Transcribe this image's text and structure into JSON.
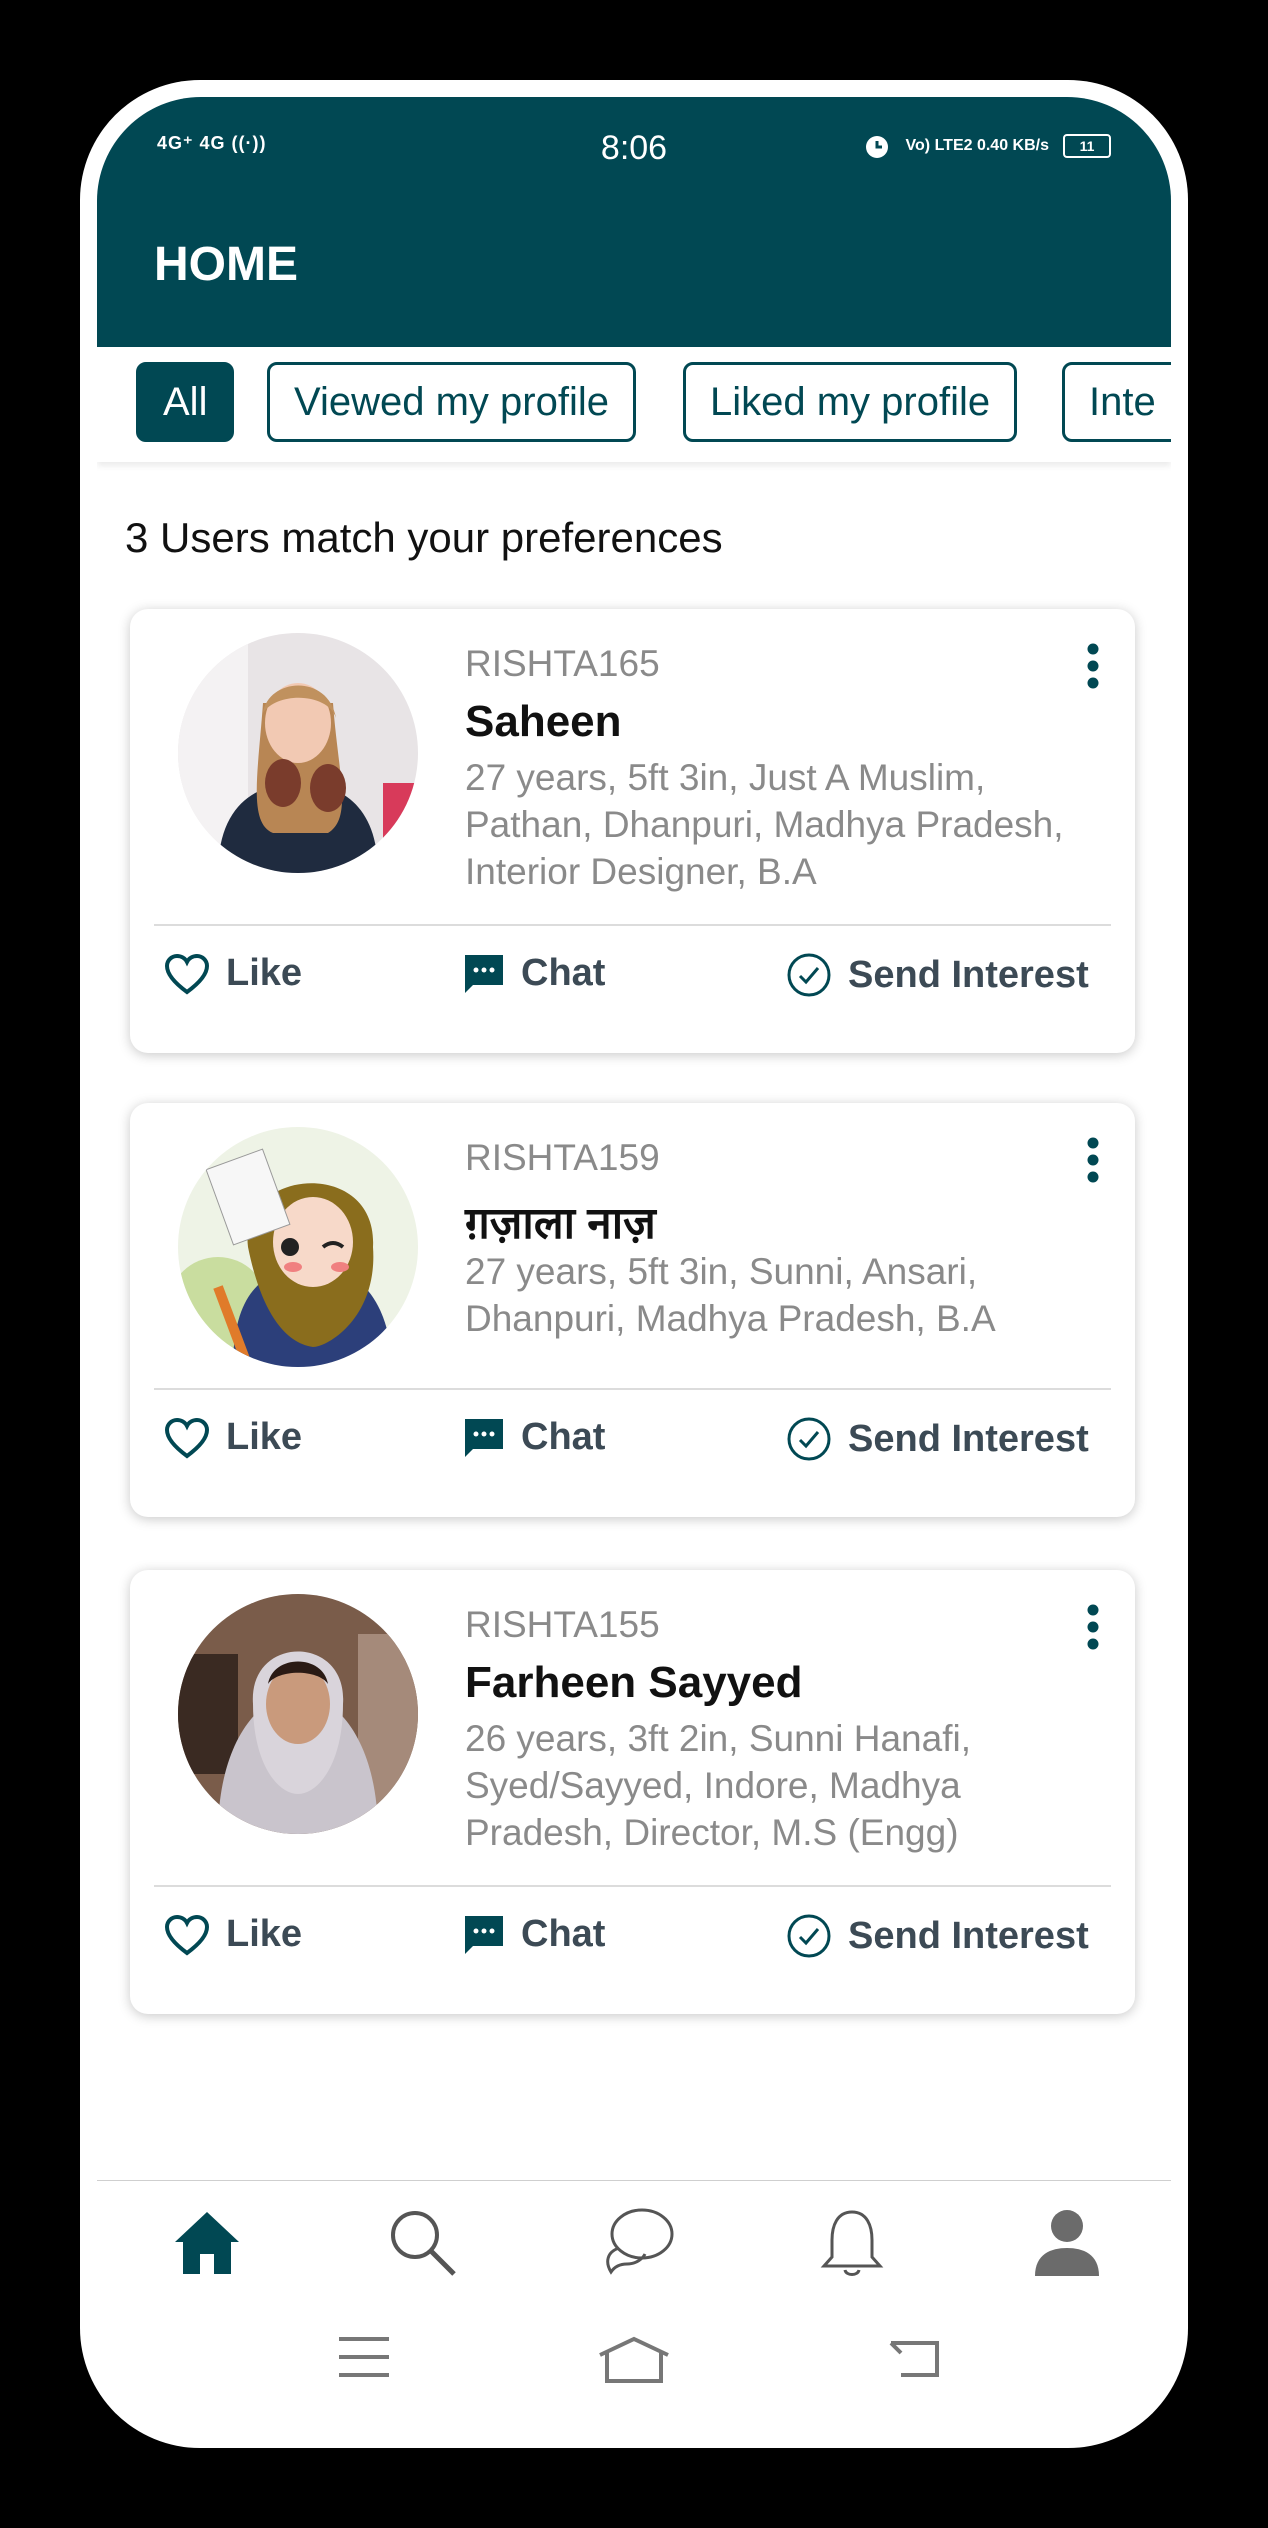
{
  "status_bar": {
    "signal_text": "4G⁺ 4G ((·))",
    "time": "8:06",
    "right_text": "Vo) LTE2 0.40 KB/s",
    "battery": "11"
  },
  "header": {
    "title": "HOME"
  },
  "tabs": [
    {
      "label": "All",
      "active": true
    },
    {
      "label": "Viewed my profile",
      "active": false
    },
    {
      "label": "Liked my profile",
      "active": false
    },
    {
      "label": "Inte",
      "active": false
    }
  ],
  "match_text": "3 Users match your preferences",
  "profiles": [
    {
      "id": "RISHTA165",
      "name": "Saheen",
      "details": "27 years, 5ft 3in, Just A Muslim, Pathan, Dhanpuri, Madhya Pradesh, Interior Designer, B.A"
    },
    {
      "id": "RISHTA159",
      "name": "ग़ज़ाला नाज़",
      "details": "27 years, 5ft 3in, Sunni, Ansari, Dhanpuri, Madhya Pradesh, B.A"
    },
    {
      "id": "RISHTA155",
      "name": "Farheen Sayyed",
      "details": "26 years, 3ft 2in, Sunni Hanafi, Syed/Sayyed, Indore, Madhya Pradesh, Director, M.S (Engg)"
    }
  ],
  "actions": {
    "like": "Like",
    "chat": "Chat",
    "send_interest": "Send Interest"
  },
  "colors": {
    "primary": "#014853",
    "muted": "#8a8a8a",
    "action": "#3c4a55"
  },
  "bottom_nav": [
    "home-icon",
    "search-icon",
    "chat-bubble-icon",
    "bell-icon",
    "profile-icon"
  ]
}
